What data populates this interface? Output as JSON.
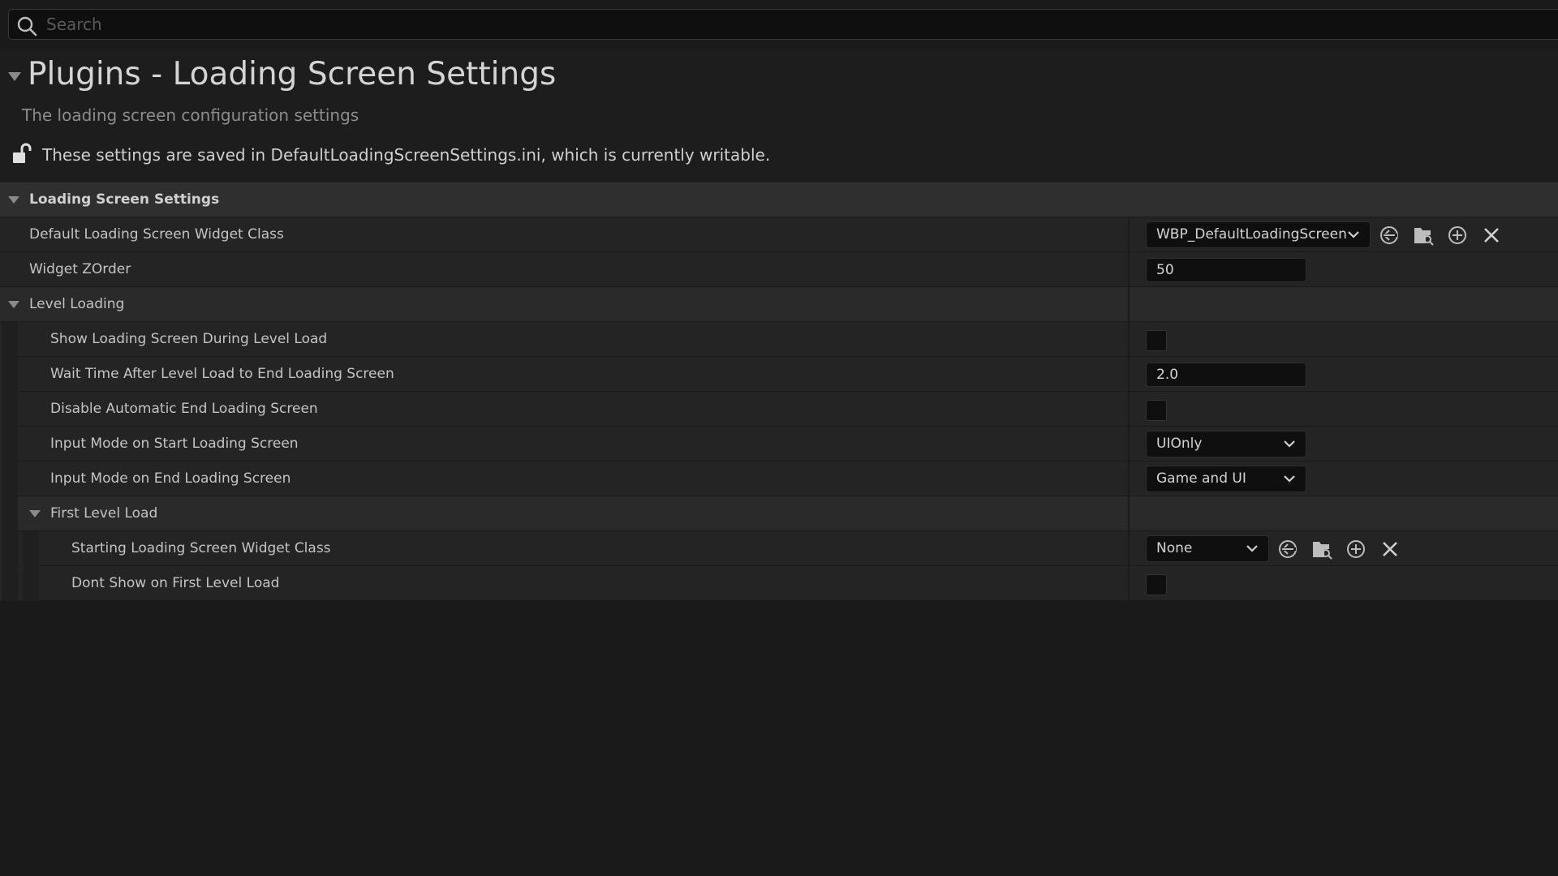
{
  "search": {
    "placeholder": "Search"
  },
  "header": {
    "title": "Plugins - Loading Screen Settings",
    "subtitle": "The loading screen configuration settings",
    "notice": "These settings are saved in DefaultLoadingScreenSettings.ini, which is currently writable."
  },
  "category": {
    "label": "Loading Screen Settings"
  },
  "props": {
    "default_widget_class": {
      "label": "Default Loading Screen Widget Class",
      "value": "WBP_DefaultLoadingScreen"
    },
    "widget_zorder": {
      "label": "Widget ZOrder",
      "value": "50"
    }
  },
  "level_loading": {
    "label": "Level Loading",
    "show_during_load": {
      "label": "Show Loading Screen During Level Load",
      "checked": false
    },
    "wait_time": {
      "label": "Wait Time After Level Load to End Loading Screen",
      "value": "2.0"
    },
    "disable_auto_end": {
      "label": "Disable Automatic End Loading Screen",
      "checked": false
    },
    "input_mode_start": {
      "label": "Input Mode on Start Loading Screen",
      "value": "UIOnly"
    },
    "input_mode_end": {
      "label": "Input Mode on End Loading Screen",
      "value": "Game and UI"
    }
  },
  "first_level_load": {
    "label": "First Level Load",
    "starting_widget_class": {
      "label": "Starting Loading Screen Widget Class",
      "value": "None"
    },
    "dont_show_first": {
      "label": "Dont Show on First Level Load",
      "checked": false
    }
  },
  "icons": {
    "search": "search-icon",
    "lock": "unlock-icon",
    "use_selected": "arrow-left-circle-icon",
    "browse": "folder-search-icon",
    "add": "plus-circle-icon",
    "clear": "close-icon"
  }
}
